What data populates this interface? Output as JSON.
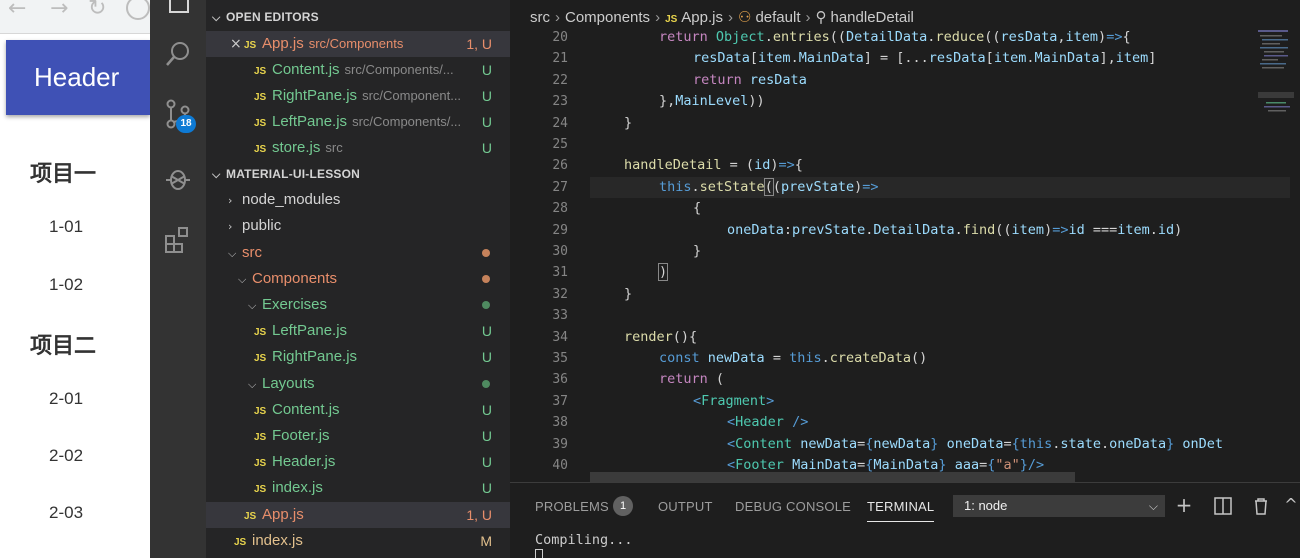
{
  "browser": {
    "header_text": "Header",
    "groups": [
      {
        "title": "项目一",
        "items": [
          "1-01",
          "1-02"
        ]
      },
      {
        "title": "项目二",
        "items": [
          "2-01",
          "2-02",
          "2-03"
        ]
      }
    ]
  },
  "activity_bar": {
    "source_control_badge": "18"
  },
  "explorer": {
    "open_editors_title": "OPEN EDITORS",
    "project_title": "MATERIAL-UI-LESSON",
    "open_editors": [
      {
        "name": "App.js",
        "path": "src/Components",
        "status": "1, U"
      },
      {
        "name": "Content.js",
        "path": "src/Components/...",
        "status": "U"
      },
      {
        "name": "RightPane.js",
        "path": "src/Component...",
        "status": "U"
      },
      {
        "name": "LeftPane.js",
        "path": "src/Components/...",
        "status": "U"
      },
      {
        "name": "store.js",
        "path": "src",
        "status": "U"
      }
    ],
    "tree": [
      {
        "name": "node_modules"
      },
      {
        "name": "public"
      },
      {
        "name": "src"
      },
      {
        "name": "Components"
      },
      {
        "name": "Exercises"
      },
      {
        "name": "LeftPane.js",
        "status": "U"
      },
      {
        "name": "RightPane.js",
        "status": "U"
      },
      {
        "name": "Layouts"
      },
      {
        "name": "Content.js",
        "status": "U"
      },
      {
        "name": "Footer.js",
        "status": "U"
      },
      {
        "name": "Header.js",
        "status": "U"
      },
      {
        "name": "index.js",
        "status": "U"
      },
      {
        "name": "App.js",
        "status": "1, U"
      },
      {
        "name": "index.js",
        "status": "M"
      }
    ]
  },
  "editor": {
    "breadcrumb": [
      "src",
      "Components",
      "App.js",
      "default",
      "handleDetail"
    ],
    "line_numbers": [
      "20",
      "21",
      "22",
      "23",
      "24",
      "25",
      "26",
      "27",
      "28",
      "29",
      "30",
      "31",
      "32",
      "33",
      "34",
      "35",
      "36",
      "37",
      "38",
      "39",
      "40"
    ]
  },
  "panel": {
    "tabs": [
      "PROBLEMS",
      "OUTPUT",
      "DEBUG CONSOLE",
      "TERMINAL"
    ],
    "problems_count": "1",
    "terminal_selector": "1: node",
    "terminal_output": "Compiling..."
  }
}
